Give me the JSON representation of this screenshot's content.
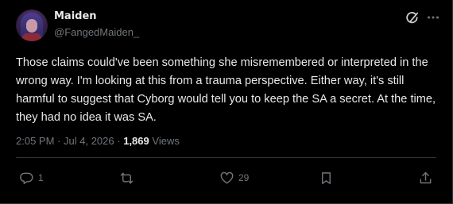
{
  "author": {
    "display_name": "Maiden",
    "handle": "@FangedMaiden_"
  },
  "post": {
    "text": "Those claims could've been something she misremembered or interpreted in the wrong way. I'm looking at this from a trauma perspective. Either way, it's still harmful to suggest that Cyborg would tell you to keep the SA a secret. At the time, they had no idea it was SA.",
    "time": "2:05 PM",
    "separator_1": "·",
    "date": "Jul 4, 2026",
    "separator_2": "·",
    "views_count": "1,869",
    "views_label": "Views"
  },
  "actions": {
    "reply_count": "1",
    "repost_count": "",
    "like_count": "29"
  },
  "icons": {
    "grok": "grok-icon",
    "more": "more-options-icon",
    "reply": "reply-bubble-icon",
    "repost": "repost-arrows-icon",
    "like": "heart-icon",
    "bookmark": "bookmark-icon",
    "share": "share-upload-icon"
  },
  "colors": {
    "background": "#000000",
    "text_primary": "#e7e9ea",
    "text_secondary": "#71767b",
    "divider": "#2f3336"
  }
}
